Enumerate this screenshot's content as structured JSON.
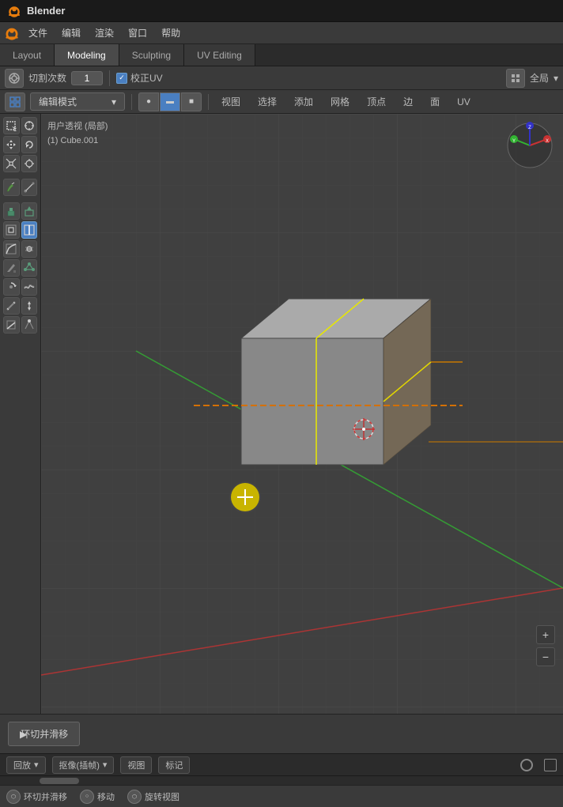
{
  "app": {
    "title": "Blender",
    "logo_symbol": "⬡"
  },
  "title_bar": {
    "title": "Blender"
  },
  "menu_bar": {
    "items": [
      "文件",
      "编辑",
      "渲染",
      "窗口",
      "帮助"
    ]
  },
  "workspace_tabs": {
    "tabs": [
      "Layout",
      "Modeling",
      "Sculpting",
      "UV Editing"
    ],
    "active": "Modeling"
  },
  "header_toolbar": {
    "cut_label": "切割次数",
    "cut_value": "1",
    "correct_uv_label": "校正UV",
    "view_label": "全局",
    "menu_global": "全局"
  },
  "mode_toolbar": {
    "mode": "编辑模式",
    "menu_items": [
      "视图",
      "选择",
      "添加",
      "网格",
      "顶点",
      "边",
      "面",
      "UV"
    ]
  },
  "viewport": {
    "info_line1": "用户透视 (局部)",
    "info_line2": "(1) Cube.001"
  },
  "left_toolbar": {
    "tools": [
      {
        "name": "select-box",
        "symbol": "▢",
        "active": false
      },
      {
        "name": "cursor-tool",
        "symbol": "⊕",
        "active": false
      },
      {
        "name": "move-tool",
        "symbol": "✥",
        "active": false
      },
      {
        "name": "rotate-tool",
        "symbol": "↻",
        "active": false
      },
      {
        "name": "scale-tool",
        "symbol": "⤢",
        "active": false
      },
      {
        "name": "transform-tool",
        "symbol": "⊕",
        "active": false
      },
      {
        "name": "annotate-tool",
        "symbol": "✏",
        "active": false
      },
      {
        "name": "measure-tool",
        "symbol": "📏",
        "active": false
      },
      {
        "name": "face-sel",
        "symbol": "◼",
        "active": false
      },
      {
        "name": "edge-sel",
        "symbol": "◻",
        "active": false
      },
      {
        "name": "loop-cut",
        "symbol": "⊟",
        "active": true
      },
      {
        "name": "edge-slide",
        "symbol": "⟺",
        "active": false
      },
      {
        "name": "inset",
        "symbol": "⬜",
        "active": false
      },
      {
        "name": "bevel",
        "symbol": "◤",
        "active": false
      },
      {
        "name": "extrude",
        "symbol": "↑",
        "active": false
      },
      {
        "name": "extrude2",
        "symbol": "⬆",
        "active": false
      },
      {
        "name": "knife",
        "symbol": "✂",
        "active": false
      },
      {
        "name": "poly-build",
        "symbol": "⬡",
        "active": false
      },
      {
        "name": "spin",
        "symbol": "⟳",
        "active": false
      },
      {
        "name": "smooth",
        "symbol": "~",
        "active": false
      },
      {
        "name": "edge-crease",
        "symbol": "≈",
        "active": false
      },
      {
        "name": "shear",
        "symbol": "/",
        "active": false
      },
      {
        "name": "rip",
        "symbol": "⌃",
        "active": false
      },
      {
        "name": "push-pull",
        "symbol": "↕",
        "active": false
      }
    ]
  },
  "operator_panel": {
    "btn_label": "▶ 环切并滑移"
  },
  "timeline": {
    "playback_label": "回放",
    "keying_label": "抠像(插帧)",
    "view_label": "视图",
    "markers_label": "标记"
  },
  "footer": {
    "items": [
      {
        "icon": "loop-icon",
        "label": "环切并滑移"
      },
      {
        "icon": "move-icon",
        "label": "移动"
      },
      {
        "icon": "orbit-icon",
        "label": "旋转视图"
      }
    ]
  },
  "colors": {
    "accent_blue": "#4a7fc1",
    "axis_red": "#c83232",
    "axis_green": "#32b432",
    "axis_yellow": "#c8c800",
    "selection_yellow": "#e8e800",
    "cursor_yellow": "#c8b400",
    "dashed_orange": "#d47000"
  }
}
